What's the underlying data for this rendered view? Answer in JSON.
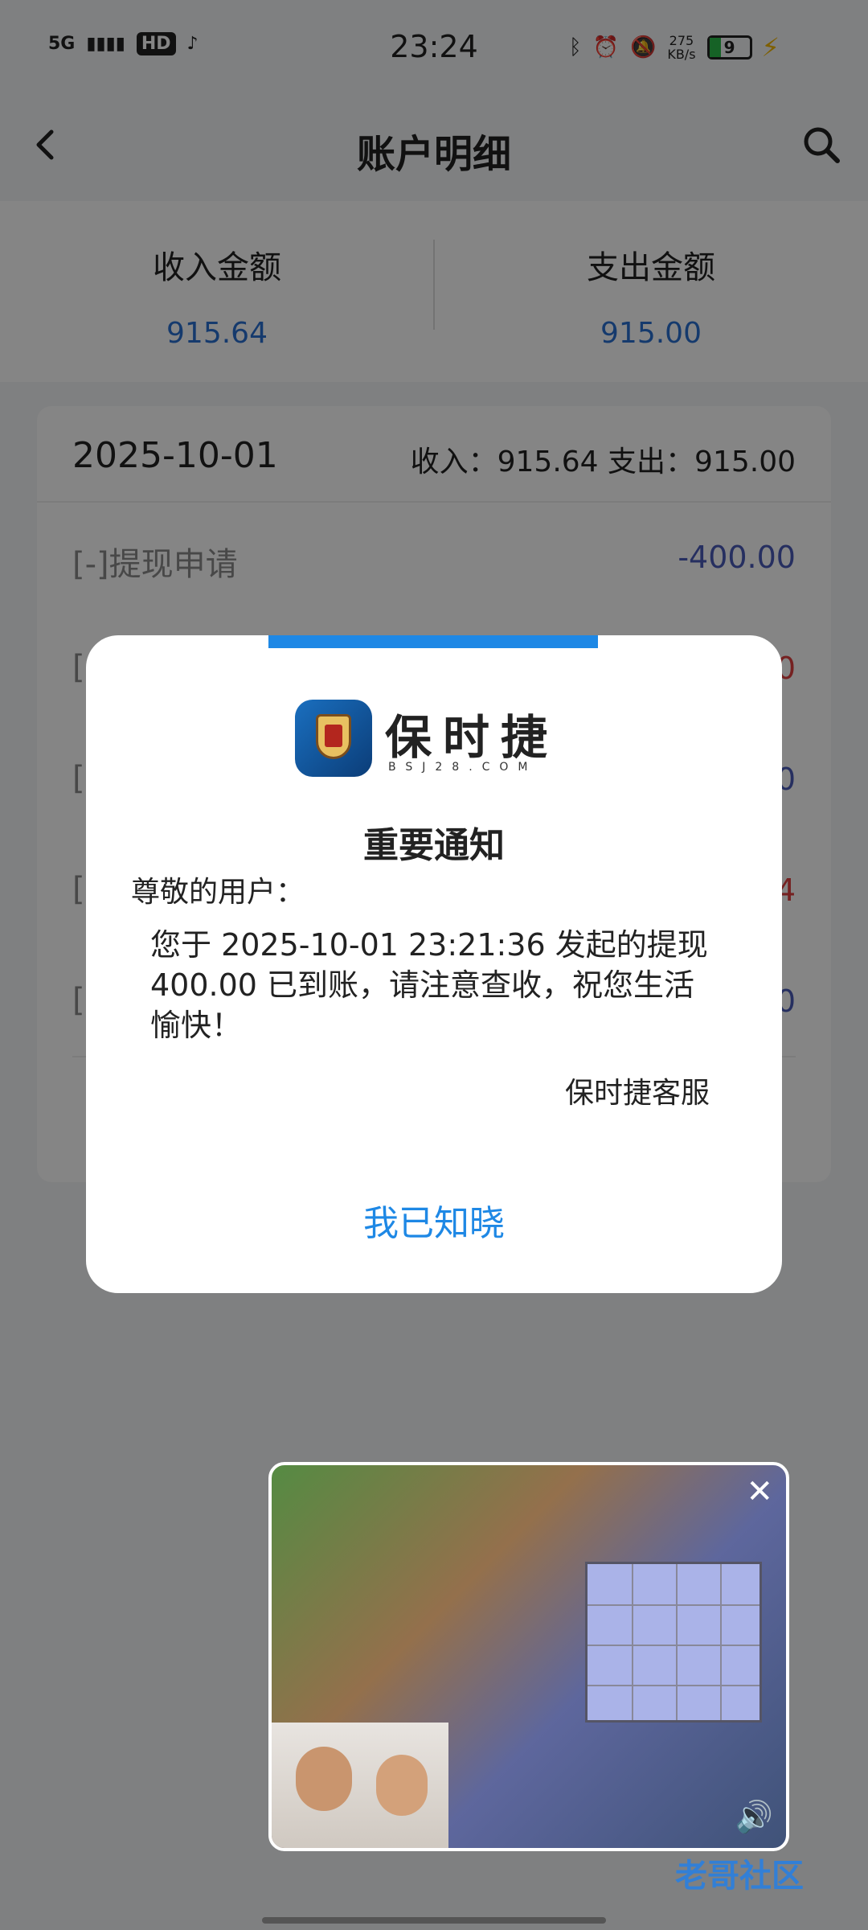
{
  "status_bar": {
    "network": "5G",
    "hd_badge": "HD",
    "time": "23:24",
    "speed_value": "275",
    "speed_unit": "KB/s",
    "battery": "9"
  },
  "header": {
    "title": "账户明细"
  },
  "summary": {
    "income_label": "收入金额",
    "income_value": "915.64",
    "expense_label": "支出金额",
    "expense_value": "915.00"
  },
  "card": {
    "date": "2025-10-01",
    "totals": "收入：915.64 支出：915.00",
    "rows": [
      {
        "label": "[-]提现申请",
        "amount": "-400.00"
      },
      {
        "label": "[",
        "amount": "0"
      },
      {
        "label": "[",
        "amount": "0"
      },
      {
        "label": "[",
        "amount": "4"
      },
      {
        "label": "[",
        "amount": "0"
      }
    ]
  },
  "modal": {
    "brand_name": "保时捷",
    "brand_domain": "BSJ28.COM",
    "notice_title": "重要通知",
    "greeting": "尊敬的用户：",
    "message": "您于 2025-10-01 23:21:36 发起的提现 400.00 已到账，请注意查收，祝您生活愉快！",
    "signature": "保时捷客服",
    "ack_button": "我已知晓"
  },
  "watermark": "老哥社区",
  "colors": {
    "accent": "#1e88e5",
    "income_blue": "#2a6fd1",
    "negative": "#4a5bb8",
    "positive": "#e04040"
  }
}
